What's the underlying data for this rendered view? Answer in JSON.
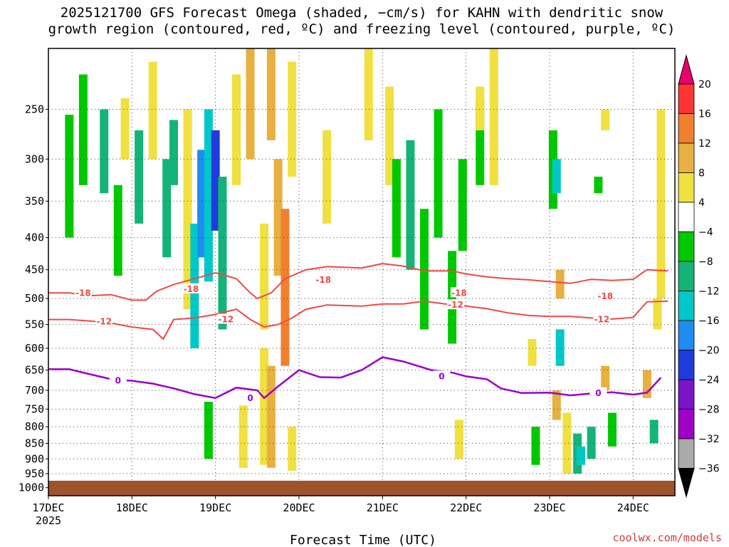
{
  "title_line1": "2025121700 GFS Forecast Omega (shaded, −cm/s) for KAHN with dendritic snow",
  "title_line2": "growth region (contoured, red, ºC) and freezing level (contoured, purple, ºC)",
  "credit": "coolwx.com/models",
  "chart_data": {
    "type": "heatmap",
    "xlabel": "Forecast Time (UTC)",
    "ylabel": "",
    "x_range": [
      "2025-12-17T00",
      "2025-12-24T12"
    ],
    "x_ticks": [
      {
        "label": "17DEC",
        "t": 0
      },
      {
        "label": "18DEC",
        "t": 24
      },
      {
        "label": "19DEC",
        "t": 48
      },
      {
        "label": "20DEC",
        "t": 72
      },
      {
        "label": "21DEC",
        "t": 96
      },
      {
        "label": "22DEC",
        "t": 120
      },
      {
        "label": "23DEC",
        "t": 144
      },
      {
        "label": "24DEC",
        "t": 168
      }
    ],
    "x_year_label": "2025",
    "y_ticks": [
      250,
      300,
      350,
      400,
      450,
      500,
      550,
      600,
      650,
      700,
      750,
      800,
      850,
      900,
      950,
      1000
    ],
    "y_range": [
      1030,
      200
    ],
    "y_scale": "log",
    "grid": true,
    "colorbar": {
      "labels": [
        "20",
        "16",
        "12",
        "8",
        "4",
        "−4",
        "−8",
        "−12",
        "−16",
        "−20",
        "−24",
        "−28",
        "−32",
        "−36"
      ],
      "colors": [
        "#e8006e",
        "#ff3434",
        "#f08030",
        "#e8b040",
        "#f0e040",
        "#ffffff",
        "#00c800",
        "#14b478",
        "#00c8c8",
        "#1e8cf0",
        "#1e3cdc",
        "#7a14c8",
        "#a000c8",
        "#aaaaaa",
        "#000000"
      ]
    },
    "shaded_cells": [
      {
        "t": 6,
        "p1": 255,
        "p2": 400,
        "v": -6
      },
      {
        "t": 10,
        "p1": 220,
        "p2": 330,
        "v": -7
      },
      {
        "t": 16,
        "p1": 250,
        "p2": 340,
        "v": -8
      },
      {
        "t": 20,
        "p1": 330,
        "p2": 460,
        "v": -7
      },
      {
        "t": 22,
        "p1": 240,
        "p2": 300,
        "v": 5
      },
      {
        "t": 26,
        "p1": 270,
        "p2": 380,
        "v": -9
      },
      {
        "t": 30,
        "p1": 210,
        "p2": 300,
        "v": 6
      },
      {
        "t": 34,
        "p1": 300,
        "p2": 430,
        "v": -11
      },
      {
        "t": 36,
        "p1": 260,
        "p2": 330,
        "v": -8
      },
      {
        "t": 40,
        "p1": 250,
        "p2": 520,
        "v": 5
      },
      {
        "t": 42,
        "p1": 380,
        "p2": 600,
        "v": -13
      },
      {
        "t": 44,
        "p1": 290,
        "p2": 430,
        "v": -17
      },
      {
        "t": 46,
        "p1": 250,
        "p2": 470,
        "v": -13
      },
      {
        "t": 48,
        "p1": 270,
        "p2": 390,
        "v": -21
      },
      {
        "t": 50,
        "p1": 320,
        "p2": 560,
        "v": -10
      },
      {
        "t": 54,
        "p1": 220,
        "p2": 330,
        "v": 6
      },
      {
        "t": 58,
        "p1": 200,
        "p2": 300,
        "v": 9
      },
      {
        "t": 62,
        "p1": 380,
        "p2": 560,
        "v": 7
      },
      {
        "t": 64,
        "p1": 200,
        "p2": 280,
        "v": 10
      },
      {
        "t": 66,
        "p1": 300,
        "p2": 460,
        "v": 9
      },
      {
        "t": 68,
        "p1": 360,
        "p2": 640,
        "v": 14
      },
      {
        "t": 70,
        "p1": 210,
        "p2": 320,
        "v": 7
      },
      {
        "t": 62,
        "p1": 600,
        "p2": 920,
        "v": 6
      },
      {
        "t": 64,
        "p1": 640,
        "p2": 930,
        "v": 10
      },
      {
        "t": 46,
        "p1": 730,
        "p2": 900,
        "v": -7
      },
      {
        "t": 56,
        "p1": 740,
        "p2": 930,
        "v": 5
      },
      {
        "t": 70,
        "p1": 800,
        "p2": 940,
        "v": 5
      },
      {
        "t": 80,
        "p1": 270,
        "p2": 380,
        "v": 6
      },
      {
        "t": 92,
        "p1": 200,
        "p2": 280,
        "v": 5
      },
      {
        "t": 98,
        "p1": 230,
        "p2": 330,
        "v": 5
      },
      {
        "t": 100,
        "p1": 300,
        "p2": 430,
        "v": -7
      },
      {
        "t": 104,
        "p1": 280,
        "p2": 450,
        "v": -9
      },
      {
        "t": 108,
        "p1": 360,
        "p2": 560,
        "v": -6
      },
      {
        "t": 112,
        "p1": 250,
        "p2": 400,
        "v": -7
      },
      {
        "t": 116,
        "p1": 420,
        "p2": 590,
        "v": -6
      },
      {
        "t": 119,
        "p1": 300,
        "p2": 420,
        "v": -6
      },
      {
        "t": 124,
        "p1": 240,
        "p2": 330,
        "v": -7
      },
      {
        "t": 128,
        "p1": 200,
        "p2": 330,
        "v": 5
      },
      {
        "t": 124,
        "p1": 230,
        "p2": 270,
        "v": 6
      },
      {
        "t": 118,
        "p1": 780,
        "p2": 900,
        "v": 5
      },
      {
        "t": 139,
        "p1": 580,
        "p2": 640,
        "v": 6
      },
      {
        "t": 145,
        "p1": 270,
        "p2": 360,
        "v": -7
      },
      {
        "t": 146,
        "p1": 300,
        "p2": 340,
        "v": -14
      },
      {
        "t": 147,
        "p1": 450,
        "p2": 500,
        "v": 9
      },
      {
        "t": 147,
        "p1": 560,
        "p2": 640,
        "v": -12
      },
      {
        "t": 146,
        "p1": 700,
        "p2": 780,
        "v": 9
      },
      {
        "t": 149,
        "p1": 760,
        "p2": 950,
        "v": 5
      },
      {
        "t": 152,
        "p1": 820,
        "p2": 950,
        "v": -8
      },
      {
        "t": 153,
        "p1": 860,
        "p2": 920,
        "v": -14
      },
      {
        "t": 156,
        "p1": 800,
        "p2": 900,
        "v": -9
      },
      {
        "t": 160,
        "p1": 640,
        "p2": 700,
        "v": 9
      },
      {
        "t": 162,
        "p1": 760,
        "p2": 860,
        "v": -7
      },
      {
        "t": 140,
        "p1": 800,
        "p2": 920,
        "v": -7
      },
      {
        "t": 172,
        "p1": 650,
        "p2": 720,
        "v": 9
      },
      {
        "t": 175,
        "p1": 500,
        "p2": 560,
        "v": 5
      },
      {
        "t": 176,
        "p1": 250,
        "p2": 500,
        "v": 5
      },
      {
        "t": 174,
        "p1": 780,
        "p2": 850,
        "v": -8
      },
      {
        "t": 158,
        "p1": 320,
        "p2": 340,
        "v": -6
      },
      {
        "t": 160,
        "p1": 250,
        "p2": 270,
        "v": 5
      }
    ],
    "contours": [
      {
        "name": "-18",
        "color": "#f04848",
        "width": 2,
        "label_at_t": [
          [
            10,
            490
          ],
          [
            41,
            483
          ],
          [
            79,
            467
          ],
          [
            118,
            490
          ],
          [
            160,
            496
          ]
        ],
        "points": [
          [
            0,
            490
          ],
          [
            6,
            490
          ],
          [
            12,
            495
          ],
          [
            18,
            493
          ],
          [
            24,
            503
          ],
          [
            28,
            503
          ],
          [
            31,
            487
          ],
          [
            36,
            475
          ],
          [
            42,
            465
          ],
          [
            48,
            455
          ],
          [
            54,
            465
          ],
          [
            58,
            490
          ],
          [
            60,
            500
          ],
          [
            64,
            490
          ],
          [
            68,
            465
          ],
          [
            74,
            450
          ],
          [
            80,
            445
          ],
          [
            90,
            447
          ],
          [
            96,
            440
          ],
          [
            102,
            444
          ],
          [
            108,
            452
          ],
          [
            116,
            452
          ],
          [
            120,
            457
          ],
          [
            126,
            462
          ],
          [
            132,
            465
          ],
          [
            138,
            467
          ],
          [
            144,
            470
          ],
          [
            150,
            473
          ],
          [
            156,
            466
          ],
          [
            162,
            468
          ],
          [
            168,
            466
          ],
          [
            172,
            450
          ],
          [
            178,
            452
          ]
        ]
      },
      {
        "name": "-12",
        "color": "#f04848",
        "width": 2,
        "label_at_t": [
          [
            16,
            544
          ],
          [
            51,
            540
          ],
          [
            117,
            512
          ],
          [
            159,
            540
          ]
        ],
        "points": [
          [
            0,
            540
          ],
          [
            6,
            540
          ],
          [
            12,
            543
          ],
          [
            18,
            547
          ],
          [
            24,
            555
          ],
          [
            30,
            560
          ],
          [
            33,
            580
          ],
          [
            36,
            540
          ],
          [
            42,
            537
          ],
          [
            48,
            530
          ],
          [
            54,
            520
          ],
          [
            58,
            540
          ],
          [
            62,
            555
          ],
          [
            66,
            550
          ],
          [
            70,
            537
          ],
          [
            74,
            520
          ],
          [
            80,
            512
          ],
          [
            90,
            514
          ],
          [
            96,
            510
          ],
          [
            102,
            510
          ],
          [
            108,
            505
          ],
          [
            114,
            510
          ],
          [
            120,
            514
          ],
          [
            126,
            519
          ],
          [
            132,
            527
          ],
          [
            138,
            532
          ],
          [
            144,
            534
          ],
          [
            150,
            534
          ],
          [
            156,
            537
          ],
          [
            162,
            539
          ],
          [
            168,
            536
          ],
          [
            172,
            506
          ],
          [
            178,
            505
          ]
        ]
      },
      {
        "name": "0",
        "color": "#9900cc",
        "width": 2.5,
        "label_at_t": [
          [
            20,
            676
          ],
          [
            58,
            720
          ],
          [
            113,
            665
          ],
          [
            158,
            707
          ]
        ],
        "points": [
          [
            0,
            648
          ],
          [
            6,
            648
          ],
          [
            12,
            660
          ],
          [
            18,
            672
          ],
          [
            24,
            676
          ],
          [
            30,
            683
          ],
          [
            36,
            695
          ],
          [
            42,
            710
          ],
          [
            48,
            720
          ],
          [
            54,
            693
          ],
          [
            60,
            700
          ],
          [
            62,
            720
          ],
          [
            66,
            690
          ],
          [
            72,
            650
          ],
          [
            78,
            667
          ],
          [
            84,
            668
          ],
          [
            90,
            650
          ],
          [
            96,
            620
          ],
          [
            102,
            630
          ],
          [
            110,
            650
          ],
          [
            116,
            656
          ],
          [
            120,
            665
          ],
          [
            126,
            672
          ],
          [
            130,
            695
          ],
          [
            136,
            707
          ],
          [
            144,
            706
          ],
          [
            150,
            713
          ],
          [
            156,
            708
          ],
          [
            162,
            705
          ],
          [
            168,
            711
          ],
          [
            172,
            706
          ],
          [
            176,
            668
          ]
        ]
      }
    ],
    "ground": {
      "from_p": 975,
      "to_p": 1030
    }
  }
}
